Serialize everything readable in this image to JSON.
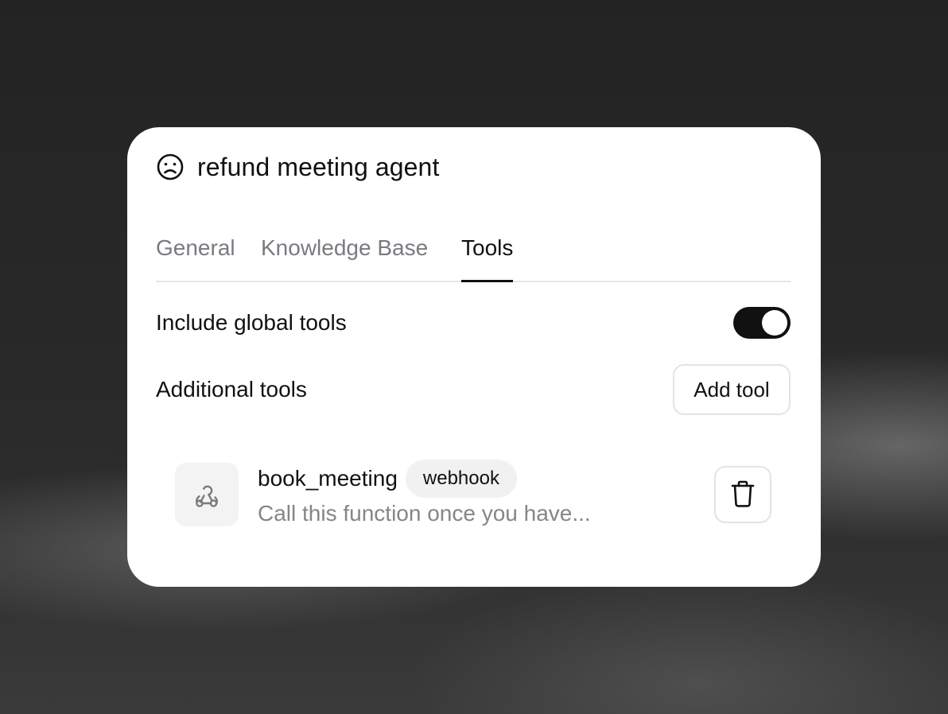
{
  "agent": {
    "icon": "face-frown-icon",
    "title": "refund meeting agent"
  },
  "tabs": [
    {
      "label": "General",
      "active": false
    },
    {
      "label": "Knowledge Base",
      "active": false
    },
    {
      "label": "Tools",
      "active": true
    }
  ],
  "global_tools": {
    "label": "Include global tools",
    "enabled": true
  },
  "additional_tools": {
    "label": "Additional tools",
    "add_label": "Add tool"
  },
  "tools": [
    {
      "name": "book_meeting",
      "badge": "webhook",
      "description": "Call this function once you have...",
      "icon": "webhook-icon",
      "delete_icon": "trash-icon"
    }
  ],
  "colors": {
    "accent": "#111111",
    "muted_text": "#7a7a80",
    "badge_bg": "#f1f1f1"
  }
}
